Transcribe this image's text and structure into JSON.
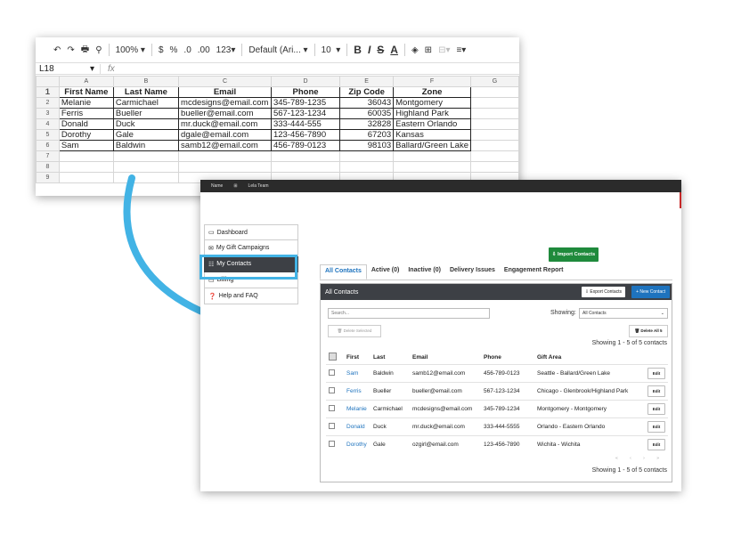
{
  "sheet": {
    "toolbar": {
      "undo": "↶",
      "redo": "↷",
      "print": "🖶",
      "paint": "⚲",
      "zoom": "100%",
      "currency": "$",
      "percent": "%",
      "dec_less": ".0",
      "dec_more": ".00",
      "format": "123",
      "font": "Default (Ari...",
      "font_size": "10",
      "bold": "B",
      "italic": "I",
      "strike": "S",
      "text_color": "A"
    },
    "cell_ref": "L18",
    "fx": "fx",
    "col_letters": [
      "A",
      "B",
      "C",
      "D",
      "E",
      "F",
      "G"
    ],
    "headers": [
      "First Name",
      "Last Name",
      "Email",
      "Phone",
      "Zip Code",
      "Zone"
    ],
    "rows": [
      [
        "Melanie",
        "Carmichael",
        "mcdesigns@email.com",
        "345-789-1235",
        "36043",
        "Montgomery"
      ],
      [
        "Ferris",
        "Bueller",
        "bueller@email.com",
        "567-123-1234",
        "60035",
        "Highland Park"
      ],
      [
        "Donald",
        "Duck",
        "mr.duck@email.com",
        "333-444-555",
        "32828",
        "Eastern Orlando"
      ],
      [
        "Dorothy",
        "Gale",
        "dgale@email.com",
        "123-456-7890",
        "67203",
        "Kansas"
      ],
      [
        "Sam",
        "Baldwin",
        "samb12@email.com",
        "456-789-0123",
        "98103",
        "Ballard/Green Lake"
      ]
    ],
    "row_numbers": [
      "1",
      "2",
      "3",
      "4",
      "5",
      "6",
      "7",
      "8",
      "9"
    ]
  },
  "app": {
    "topbar": {
      "left": "Name",
      "sep": "⊞",
      "right": "Lela Team"
    },
    "sidebar": [
      {
        "label": "Dashboard",
        "icon": "▭"
      },
      {
        "label": "My Gift Campaigns",
        "icon": "✉"
      },
      {
        "label": "My Contacts",
        "icon": "☷"
      },
      {
        "label": "Billing",
        "icon": "▭"
      },
      {
        "label": "Help and FAQ",
        "icon": "❓"
      }
    ],
    "import_button": "⇩ Import Contacts",
    "tabs": [
      "All Contacts",
      "Active (0)",
      "Inactive (0)",
      "Delivery Issues",
      "Engagement Report"
    ],
    "panel": {
      "title": "All Contacts",
      "export_button": "⇩ Export Contacts",
      "new_contact_button": "+ New Contact",
      "search_placeholder": "Search...",
      "showing_label": "Showing:",
      "showing_value": "All Contacts",
      "delete_selected": "🗑 Delete Selected",
      "delete_all": "🗑 Delete All 5",
      "showing_count": "Showing 1 - 5 of 5 contacts",
      "pager": "« ‹ › »",
      "columns": [
        "First",
        "Last",
        "Email",
        "Phone",
        "Gift Area"
      ],
      "edit_label": "Edit",
      "contacts": [
        [
          "Sam",
          "Baldwin",
          "samb12@email.com",
          "456-789-0123",
          "Seattle - Ballard/Green Lake"
        ],
        [
          "Ferris",
          "Bueller",
          "bueller@email.com",
          "567-123-1234",
          "Chicago - Glenbrook/Highland Park"
        ],
        [
          "Melanie",
          "Carmichael",
          "mcdesigns@email.com",
          "345-789-1234",
          "Montgomery - Montgomery"
        ],
        [
          "Donald",
          "Duck",
          "mr.duck@email.com",
          "333-444-5555",
          "Orlando - Eastern Orlando"
        ],
        [
          "Dorothy",
          "Gale",
          "ozgirl@email.com",
          "123-456-7890",
          "Wichita - Wichita"
        ]
      ]
    }
  },
  "colors": {
    "arrow": "#42b3e5",
    "accent": "#1e73be",
    "import": "#1f8a3c",
    "dark": "#3d4045"
  }
}
